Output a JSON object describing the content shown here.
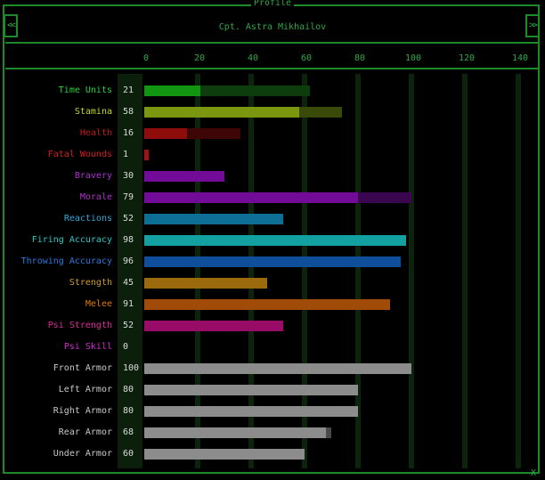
{
  "window": {
    "title": "Profile",
    "soldier_name": "Cpt. Astra Mikhailov",
    "prev_label": "<<",
    "next_label": ">>",
    "close_label": "X"
  },
  "scale": {
    "max": 150,
    "ticks": [
      "0",
      "20",
      "40",
      "60",
      "80",
      "100",
      "120",
      "140"
    ]
  },
  "stats": [
    {
      "key": "time-units",
      "label": "Time Units",
      "value": "21",
      "current": 21,
      "max": 62,
      "label_color": "#2fd13a",
      "cur_color": "#129612",
      "max_color": "#0d3d0d"
    },
    {
      "key": "stamina",
      "label": "Stamina",
      "value": "58",
      "current": 58,
      "max": 74,
      "label_color": "#c4d62a",
      "cur_color": "#7b960f",
      "max_color": "#3a4a08"
    },
    {
      "key": "health",
      "label": "Health",
      "value": "16",
      "current": 16,
      "max": 36,
      "label_color": "#c41818",
      "cur_color": "#8f0c0c",
      "max_color": "#3e0606"
    },
    {
      "key": "fatal-wounds",
      "label": "Fatal Wounds",
      "value": "1",
      "current": 1,
      "max": 1,
      "label_color": "#d51d1d",
      "cur_color": "#a31212",
      "max_color": "#a31212"
    },
    {
      "key": "bravery",
      "label": "Bravery",
      "value": "30",
      "current": 30,
      "max": 30,
      "label_color": "#b030d0",
      "cur_color": "#720c98",
      "max_color": "#720c98"
    },
    {
      "key": "morale",
      "label": "Morale",
      "value": "79",
      "current": 80,
      "max": 100,
      "label_color": "#b030d0",
      "cur_color": "#720c98",
      "max_color": "#3a0650"
    },
    {
      "key": "reactions",
      "label": "Reactions",
      "value": "52",
      "current": 52,
      "max": 52,
      "label_color": "#30a8d8",
      "cur_color": "#0d6f95",
      "max_color": "#0d6f95"
    },
    {
      "key": "firing-accuracy",
      "label": "Firing Accuracy",
      "value": "98",
      "current": 98,
      "max": 98,
      "label_color": "#2ac8c8",
      "cur_color": "#12a0a0",
      "max_color": "#12a0a0"
    },
    {
      "key": "throwing-accuracy",
      "label": "Throwing Accuracy",
      "value": "96",
      "current": 96,
      "max": 96,
      "label_color": "#2a78e0",
      "cur_color": "#0e4e9a",
      "max_color": "#0e4e9a"
    },
    {
      "key": "strength",
      "label": "Strength",
      "value": "45",
      "current": 46,
      "max": 46,
      "label_color": "#d09a20",
      "cur_color": "#9a6a0c",
      "max_color": "#9a6a0c"
    },
    {
      "key": "melee",
      "label": "Melee",
      "value": "91",
      "current": 92,
      "max": 92,
      "label_color": "#e07a12",
      "cur_color": "#a04c08",
      "max_color": "#a04c08"
    },
    {
      "key": "psi-strength",
      "label": "Psi Strength",
      "value": "52",
      "current": 52,
      "max": 52,
      "label_color": "#e02a98",
      "cur_color": "#980c68",
      "max_color": "#980c68"
    },
    {
      "key": "psi-skill",
      "label": "Psi Skill",
      "value": "0",
      "current": 0,
      "max": 0,
      "label_color": "#d02ad0",
      "cur_color": "#980c98",
      "max_color": "#980c98"
    },
    {
      "key": "front-armor",
      "label": "Front Armor",
      "value": "100",
      "current": 100,
      "max": 100,
      "label_color": "#c8c8c8",
      "cur_color": "#8c8c8c",
      "max_color": "#8c8c8c"
    },
    {
      "key": "left-armor",
      "label": "Left Armor",
      "value": "80",
      "current": 80,
      "max": 80,
      "label_color": "#c8c8c8",
      "cur_color": "#8c8c8c",
      "max_color": "#8c8c8c"
    },
    {
      "key": "right-armor",
      "label": "Right Armor",
      "value": "80",
      "current": 80,
      "max": 80,
      "label_color": "#c8c8c8",
      "cur_color": "#8c8c8c",
      "max_color": "#8c8c8c"
    },
    {
      "key": "rear-armor",
      "label": "Rear Armor",
      "value": "68",
      "current": 68,
      "max": 70,
      "label_color": "#c8c8c8",
      "cur_color": "#8c8c8c",
      "max_color": "#4a4a4a"
    },
    {
      "key": "under-armor",
      "label": "Under Armor",
      "value": "60",
      "current": 60,
      "max": 60,
      "label_color": "#c8c8c8",
      "cur_color": "#8c8c8c",
      "max_color": "#8c8c8c"
    }
  ]
}
